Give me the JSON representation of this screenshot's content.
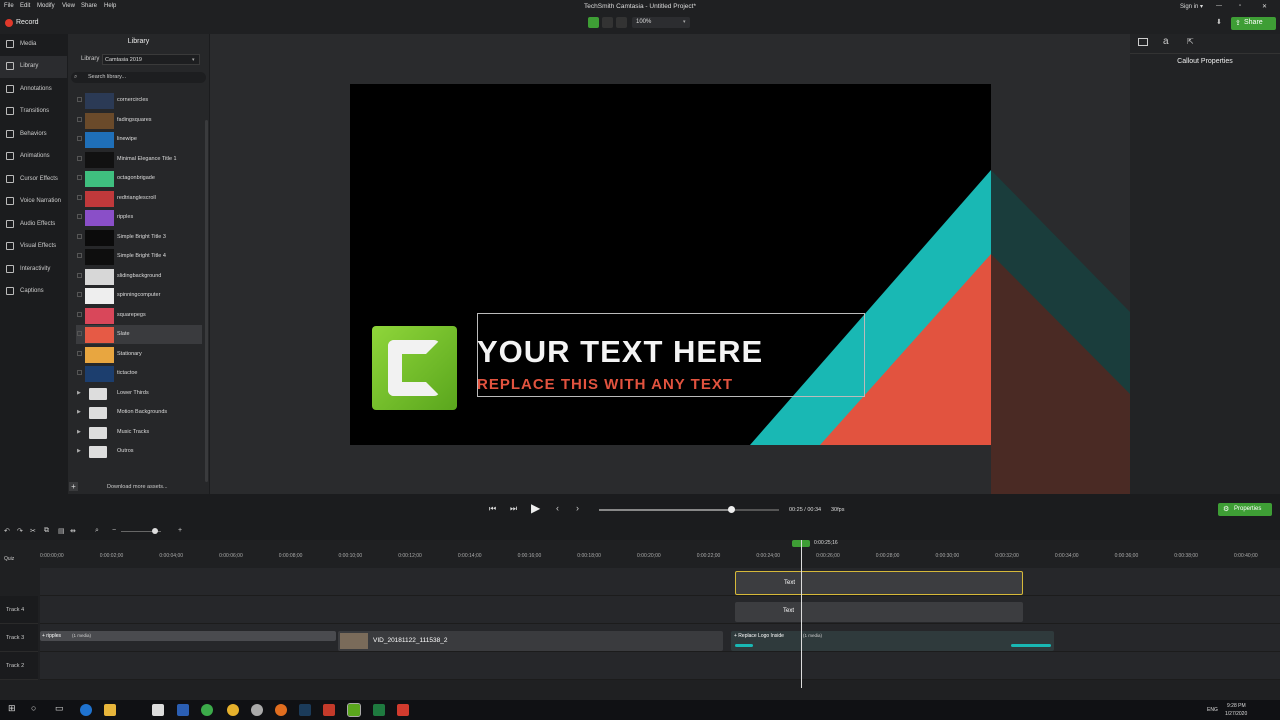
{
  "menubar": {
    "items": [
      "File",
      "Edit",
      "Modify",
      "View",
      "Share",
      "Help"
    ],
    "title": "TechSmith Camtasia - Untitled Project*",
    "sign_in": "Sign in ▾",
    "window_controls": [
      "minimize-icon",
      "maximize-icon",
      "close-icon"
    ]
  },
  "toolbar": {
    "record_label": "Record",
    "zoom": "100%",
    "share_label": "Share"
  },
  "leftnav": {
    "items": [
      {
        "label": "Media",
        "icon": "film-icon"
      },
      {
        "label": "Library",
        "icon": "library-icon"
      },
      {
        "label": "Annotations",
        "icon": "annotation-icon"
      },
      {
        "label": "Transitions",
        "icon": "transition-icon"
      },
      {
        "label": "Behaviors",
        "icon": "behavior-icon"
      },
      {
        "label": "Animations",
        "icon": "animation-icon"
      },
      {
        "label": "Cursor Effects",
        "icon": "cursor-icon"
      },
      {
        "label": "Voice Narration",
        "icon": "microphone-icon"
      },
      {
        "label": "Audio Effects",
        "icon": "audio-icon"
      },
      {
        "label": "Visual Effects",
        "icon": "visual-effects-icon"
      },
      {
        "label": "Interactivity",
        "icon": "interactivity-icon"
      },
      {
        "label": "Captions",
        "icon": "captions-icon"
      }
    ]
  },
  "library": {
    "title": "Library",
    "selector_label": "Library",
    "selector_value": "Camtasia 2019",
    "search_placeholder": "Search library...",
    "items": [
      {
        "name": "cornercircles",
        "color": "#2b3a55"
      },
      {
        "name": "fadingsquares",
        "color": "#6a4a2a"
      },
      {
        "name": "linewipe",
        "color": "#1f6fb8"
      },
      {
        "name": "Minimal Elegance Title 1",
        "color": "#111111"
      },
      {
        "name": "octagonbrigade",
        "color": "#3fbf7f"
      },
      {
        "name": "redtrianglescroll",
        "color": "#c0393b"
      },
      {
        "name": "ripples",
        "color": "#8a4fc8"
      },
      {
        "name": "Simple Bright Title 3",
        "color": "#0b0b0b"
      },
      {
        "name": "Simple Bright Title 4",
        "color": "#0e0e0e"
      },
      {
        "name": "slidingbackground",
        "color": "#d7d7d7"
      },
      {
        "name": "spinningcomputer",
        "color": "#eeeeee"
      },
      {
        "name": "squarepegs",
        "color": "#d9475a"
      },
      {
        "name": "Slate",
        "color": "#e65a45"
      },
      {
        "name": "Stationary",
        "color": "#e8a640"
      },
      {
        "name": "tictactoe",
        "color": "#1c3e6e"
      }
    ],
    "folders": [
      "Lower Thirds",
      "Motion Backgrounds",
      "Music Tracks",
      "Outros"
    ],
    "download_label": "Download more assets..."
  },
  "canvas": {
    "headline": "YOUR TEXT HERE",
    "subline": "REPLACE THIS WITH ANY TEXT",
    "colors": {
      "teal": "#19b8b4",
      "coral": "#e2533f",
      "logo_green": "#7ccb2a"
    }
  },
  "rightpanel": {
    "title": "Callout Properties",
    "properties_label": "Properties"
  },
  "playback": {
    "time": "00:25 / 00:34",
    "fps": "30fps",
    "progress": 0.735
  },
  "timeline": {
    "playhead_label": "0:00:25;16",
    "ticks": [
      "0:00:00;00",
      "0:00:02;00",
      "0:00:04;00",
      "0:00:06;00",
      "0:00:08;00",
      "0:00:10;00",
      "0:00:12;00",
      "0:00:14;00",
      "0:00:16;00",
      "0:00:18;00",
      "0:00:20;00",
      "0:00:22;00",
      "0:00:24;00",
      "0:00:26;00",
      "0:00:28;00",
      "0:00:30;00",
      "0:00:32;00",
      "0:00:34;00",
      "0:00:36;00",
      "0:00:38;00",
      "0:00:40;00"
    ],
    "quiz_label": "Quiz",
    "tracks": [
      "Track 4",
      "Track 3",
      "Track 2"
    ],
    "clips": {
      "text1": "Text",
      "text2": "Text",
      "ripples": "+ ripples",
      "ripples_sub": "(1 media)",
      "vid": "VID_20181122_111538_2",
      "replace_logo": "+ Replace Logo Inside",
      "replace_sub": "(1 media)"
    }
  },
  "taskbar": {
    "lang": "ENG",
    "time": "9:28 PM",
    "date": "1/27/2020"
  }
}
